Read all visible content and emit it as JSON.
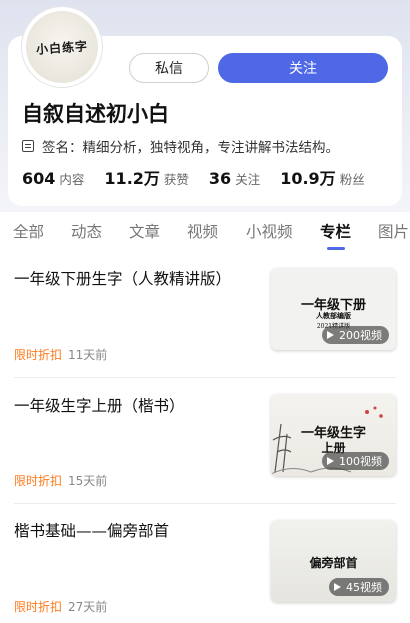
{
  "profile": {
    "avatar_text": "小白练字",
    "message_label": "私信",
    "follow_label": "关注",
    "username": "自叙自述初小白",
    "signature": "签名：精细分析，独特视角，专注讲解书法结构。",
    "stats": [
      {
        "value": "604",
        "label": "内容"
      },
      {
        "value": "11.2万",
        "label": "获赞"
      },
      {
        "value": "36",
        "label": "关注"
      },
      {
        "value": "10.9万",
        "label": "粉丝"
      }
    ]
  },
  "tabs": [
    "全部",
    "动态",
    "文章",
    "视频",
    "小视频",
    "专栏",
    "图片"
  ],
  "active_tab": "专栏",
  "items": [
    {
      "title": "一年级下册生字（人教精讲版）",
      "badge": "限时折扣",
      "date": "11天前",
      "thumb_title": "一年级下册",
      "thumb_sub1": "人教部编版",
      "thumb_sub2": "2021精讲版",
      "video_count": "200视频"
    },
    {
      "title": "一年级生字上册（楷书）",
      "badge": "限时折扣",
      "date": "15天前",
      "thumb_title": "一年级生字",
      "thumb_sub1": "上册",
      "video_count": "100视频"
    },
    {
      "title": "楷书基础——偏旁部首",
      "badge": "限时折扣",
      "date": "27天前",
      "thumb_title": "偏旁部首",
      "video_count": "45视频"
    }
  ],
  "colors": {
    "accent": "#4f68e6",
    "badge": "#ff7a1a"
  }
}
